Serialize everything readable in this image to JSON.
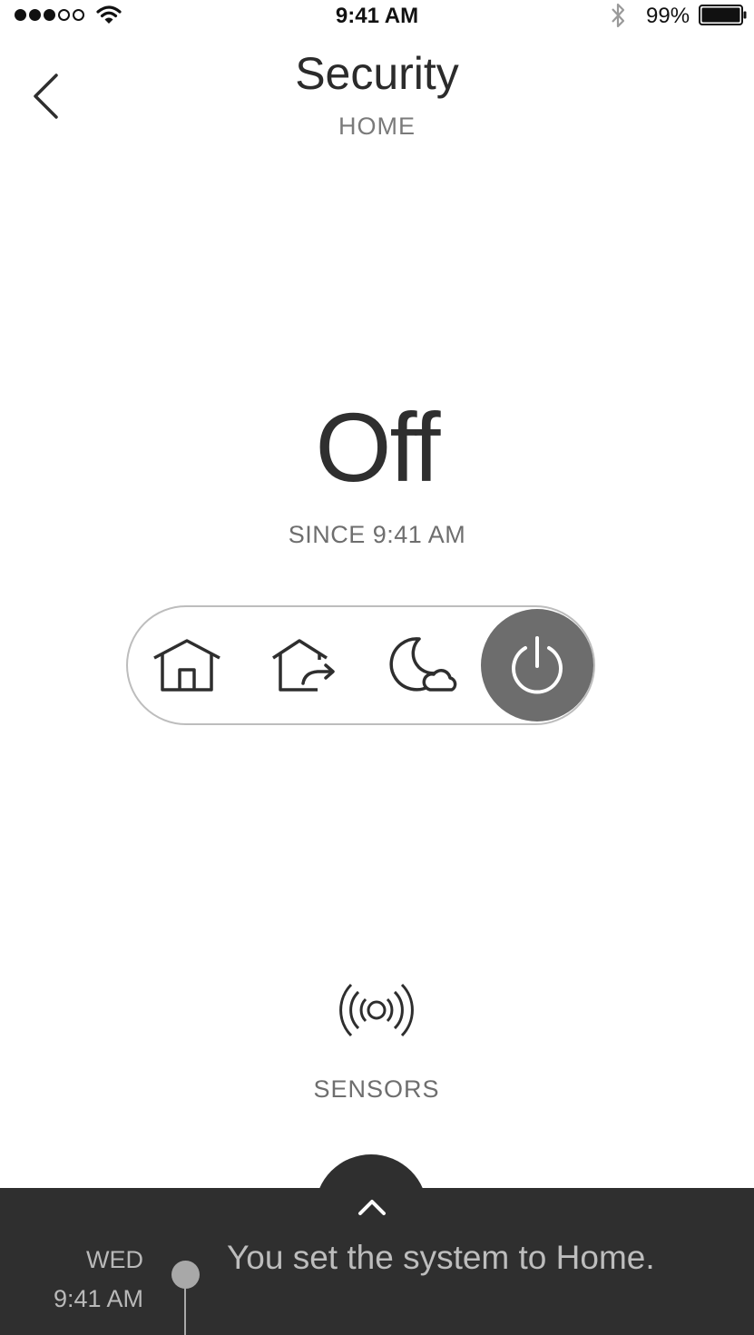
{
  "status_bar": {
    "time": "9:41 AM",
    "battery": "99%",
    "signal_bars_filled": 3,
    "signal_bars_total": 5,
    "icons": [
      "wifi-icon",
      "bluetooth-icon",
      "battery-icon"
    ]
  },
  "header": {
    "title": "Security",
    "subtitle": "HOME",
    "back_icon": "chevron-left-icon"
  },
  "state": {
    "value": "Off",
    "since": "SINCE 9:41 AM"
  },
  "modes": {
    "selected": "off",
    "items": [
      {
        "id": "home",
        "icon": "home-icon"
      },
      {
        "id": "away",
        "icon": "away-icon"
      },
      {
        "id": "night",
        "icon": "night-icon"
      },
      {
        "id": "off",
        "icon": "power-icon"
      }
    ]
  },
  "sensors": {
    "label": "SENSORS",
    "icon": "sensor-signal-icon"
  },
  "activity": {
    "expand_icon": "chevron-up-icon",
    "events": [
      {
        "day": "WED",
        "time": "9:41 AM",
        "text": "You set the system to Home."
      }
    ]
  },
  "colors": {
    "active_mode": "#6d6d6d",
    "panel_background": "#2f2f2f",
    "text_primary": "#2e2e2e",
    "text_secondary": "#6e6e6e"
  }
}
